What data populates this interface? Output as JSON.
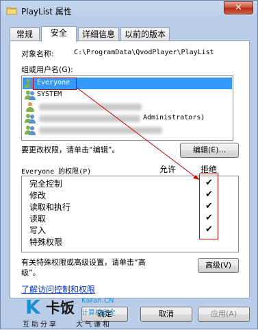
{
  "window": {
    "title": "PlayList 属性",
    "close_glyph": "✕"
  },
  "tabs": [
    {
      "label": "常规",
      "active": false
    },
    {
      "label": "安全",
      "active": true
    },
    {
      "label": "详细信息",
      "active": false
    },
    {
      "label": "以前的版本",
      "active": false
    }
  ],
  "object": {
    "label": "对象名称:",
    "value": "C:\\ProgramData\\QvodPlayer\\PlayList"
  },
  "groups": {
    "label": "组或用户名(G):",
    "items": [
      {
        "name": "Everyone",
        "selected": true
      },
      {
        "name": "SYSTEM",
        "selected": false
      },
      {
        "name": "",
        "selected": false
      },
      {
        "name": "Administrators)",
        "selected": false
      },
      {
        "name": "",
        "selected": false
      }
    ]
  },
  "edit": {
    "hint": "要更改权限，请单击“编辑”。",
    "button": "编辑(E)..."
  },
  "permissions": {
    "header": "Everyone 的权限(P)",
    "allow": "允许",
    "deny": "拒绝",
    "rows": [
      {
        "name": "完全控制",
        "allow": false,
        "deny": true
      },
      {
        "name": "修改",
        "allow": false,
        "deny": true
      },
      {
        "name": "读取和执行",
        "allow": false,
        "deny": true
      },
      {
        "name": "读取",
        "allow": false,
        "deny": true
      },
      {
        "name": "写入",
        "allow": false,
        "deny": true
      },
      {
        "name": "特殊权限",
        "allow": false,
        "deny": false
      }
    ],
    "check_glyph": "✔"
  },
  "advanced": {
    "hint_line1": "有关特殊权限或高级设置，请单击“高",
    "hint_line2": "级”。",
    "button": "高级(V)"
  },
  "link": "了解访问控制和权限",
  "footer": {
    "ok": "确定",
    "cancel": "取消",
    "apply": "应用(A)"
  },
  "watermark": {
    "logo": "K",
    "brand": "卡饭",
    "url": "KaFan.CN",
    "tagline1": "互助分享",
    "tagline2": "计算机安全",
    "tagline3": "大气谦和"
  },
  "colors": {
    "selection": "#3399ff",
    "annotation": "#d40000",
    "link": "#0033cc"
  }
}
